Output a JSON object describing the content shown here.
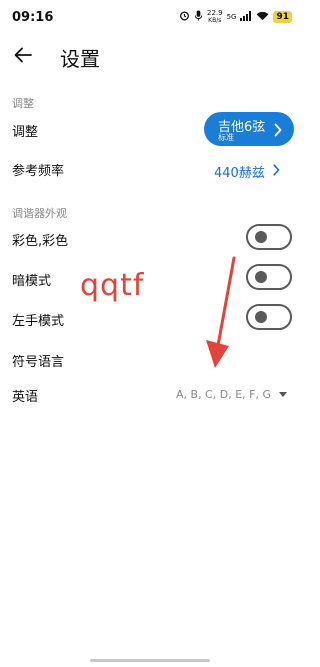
{
  "status_bar": {
    "time": "09:16",
    "net_speed_value": "22.9",
    "net_speed_unit": "KB/s",
    "network": "5G",
    "battery": "91"
  },
  "header": {
    "title": "设置",
    "back_icon": "arrow-left-icon"
  },
  "sections": {
    "tuning_section_label": "调整",
    "appearance_section_label": "调谐器外观"
  },
  "rows": {
    "tuning_label": "调整",
    "tuning_value_title": "吉他6弦",
    "tuning_value_sub": "标准",
    "freq_label": "参考频率",
    "freq_value": "440赫兹",
    "colorful_label": "彩色,彩色",
    "dark_mode_label": "暗模式",
    "left_hand_label": "左手模式",
    "notation_label": "符号语言",
    "language_label": "英语",
    "language_value": "A, B, C, D, E, F, G"
  },
  "toggles": {
    "colorful": false,
    "dark_mode": false,
    "left_hand": false
  },
  "annotation": {
    "text": "qqtf",
    "color": "#e0443a"
  },
  "colors": {
    "accent": "#1b7ed6",
    "link": "#1b6fc7",
    "battery": "#f0d040"
  }
}
